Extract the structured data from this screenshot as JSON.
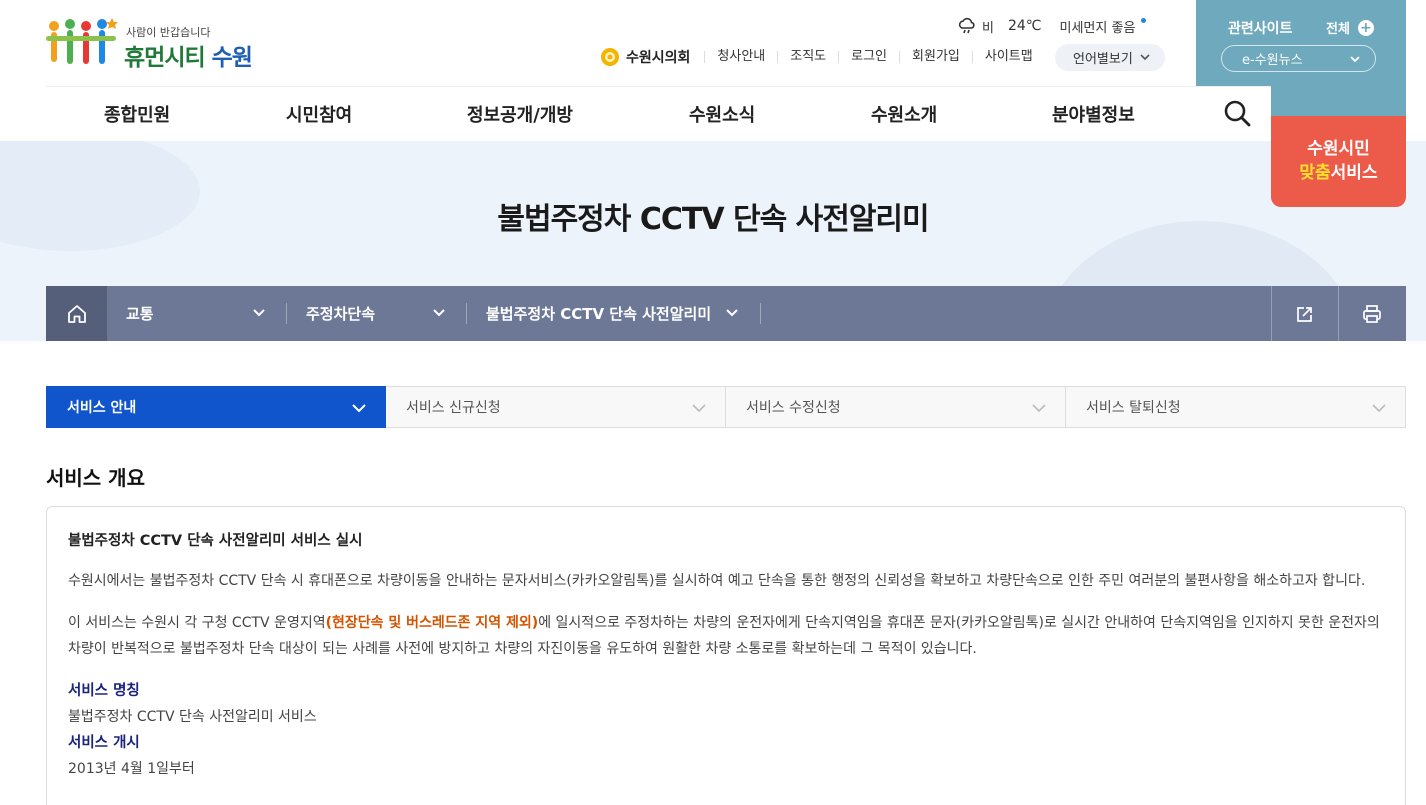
{
  "header": {
    "logo": {
      "tagline": "사람이 반갑습니다",
      "name_green": "휴먼시티",
      "name_blue": " 수원"
    },
    "weather": {
      "condition": "비",
      "temperature": "24℃",
      "dust": "미세먼지 좋음"
    },
    "util": {
      "council": "수원시의회",
      "links": [
        "청사안내",
        "조직도",
        "로그인",
        "회원가입",
        "사이트맵"
      ],
      "language": "언어별보기"
    },
    "related": {
      "title": "관련사이트",
      "all": "전체",
      "select": "e-수원뉴스"
    },
    "custom_service": {
      "line1": "수원시민",
      "line2_highlight": "맞춤",
      "line2_rest": "서비스"
    },
    "gnb": [
      "종합민원",
      "시민참여",
      "정보공개/개방",
      "수원소식",
      "수원소개",
      "분야별정보"
    ]
  },
  "visual": {
    "title": "불법주정차 CCTV 단속 사전알리미"
  },
  "location": {
    "items": [
      "교통",
      "주정차단속",
      "불법주정차 CCTV 단속 사전알리미"
    ]
  },
  "tabs": [
    "서비스 안내",
    "서비스 신규신청",
    "서비스 수정신청",
    "서비스 탈퇴신청"
  ],
  "content": {
    "section_title": "서비스 개요",
    "heading": "불법주정차 CCTV 단속 사전알리미 서비스 실시",
    "para1": "수원시에서는 불법주정차 CCTV 단속 시 휴대폰으로 차량이동을 안내하는 문자서비스(카카오알림톡)를 실시하여 예고 단속을 통한 행정의 신뢰성을 확보하고 차량단속으로 인한 주민 여러분의 불편사항을 해소하고자 합니다.",
    "para2_before": "이 서비스는 수원시 각 구청 CCTV 운영지역",
    "para2_highlight": "(현장단속 및 버스레드존 지역 제외)",
    "para2_after": "에 일시적으로 주정차하는 차량의 운전자에게 단속지역임을 휴대폰 문자(카카오알림톡)로 실시간 안내하여 단속지역임을 인지하지 못한 운전자의 차량이 반복적으로 불법주정차 단속 대상이 되는 사례를 사전에 방지하고 차량의 자진이동을 유도하여 원활한 차량 소통로를 확보하는데 그 목적이 있습니다.",
    "label_name": "서비스 명칭",
    "value_name": "불법주정차 CCTV 단속 사전알리미 서비스",
    "label_start": "서비스 개시",
    "value_start": "2013년 4월 1일부터"
  },
  "colors": {
    "accent": "#1155cc",
    "location_bar": "#6c7896",
    "related": "#6ea9bd",
    "custom": "#ec5a49"
  }
}
